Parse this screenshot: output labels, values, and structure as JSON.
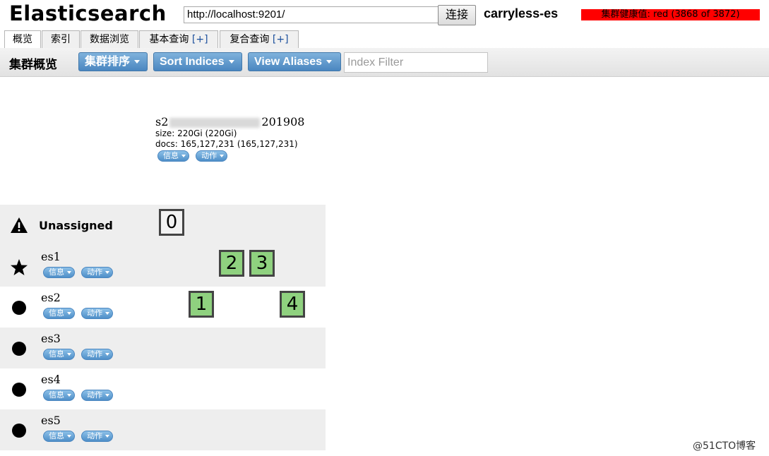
{
  "header": {
    "title": "Elasticsearch",
    "url_value": "http://localhost:9201/",
    "connect_label": "连接",
    "cluster_name": "carryless-es",
    "health_text": "集群健康值: red (3868 of 3872)",
    "health_color": "#ff0000"
  },
  "tabs": [
    {
      "label": "概览",
      "plus": ""
    },
    {
      "label": "索引",
      "plus": ""
    },
    {
      "label": "数据浏览",
      "plus": ""
    },
    {
      "label": "基本查询",
      "plus": "[+]"
    },
    {
      "label": "复合查询",
      "plus": "[+]"
    }
  ],
  "toolbar": {
    "title": "集群概览",
    "sort_cluster_label": "集群排序",
    "sort_indices_label": "Sort Indices",
    "view_aliases_label": "View Aliases",
    "filter_placeholder": "Index Filter"
  },
  "index": {
    "name_prefix": "s2",
    "name_suffix": "201908",
    "size": "size: 220Gi (220Gi)",
    "docs": "docs: 165,127,231 (165,127,231)",
    "info_label": "信息",
    "action_label": "动作"
  },
  "unassigned": {
    "label": "Unassigned",
    "icon": "warning-icon",
    "shard": "0"
  },
  "nodes": [
    {
      "name": "es1",
      "icon": "star-icon",
      "shards": [
        "2",
        "3"
      ],
      "info_label": "信息",
      "action_label": "动作"
    },
    {
      "name": "es2",
      "icon": "dot-icon",
      "shards": [
        "1",
        "4"
      ],
      "info_label": "信息",
      "action_label": "动作"
    },
    {
      "name": "es3",
      "icon": "dot-icon",
      "shards": [],
      "info_label": "信息",
      "action_label": "动作"
    },
    {
      "name": "es4",
      "icon": "dot-icon",
      "shards": [],
      "info_label": "信息",
      "action_label": "动作"
    },
    {
      "name": "es5",
      "icon": "dot-icon",
      "shards": [],
      "info_label": "信息",
      "action_label": "动作"
    }
  ],
  "watermark": "@51CTO博客",
  "colors": {
    "shard_assigned": "#8fd17f",
    "button_blue": "#4a86c0"
  }
}
